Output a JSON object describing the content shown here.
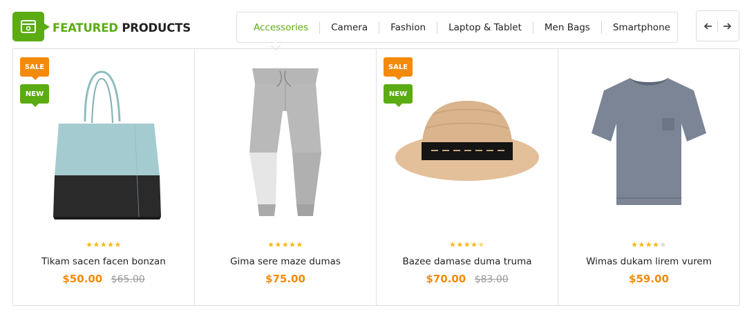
{
  "header": {
    "title_part1": "FEATURED",
    "title_part2": "PRODUCTS",
    "title_icon": "window-icon",
    "accent_color": "#5bac12"
  },
  "tabs": [
    {
      "label": "Accessories",
      "active": true
    },
    {
      "label": "Camera",
      "active": false
    },
    {
      "label": "Fashion",
      "active": false
    },
    {
      "label": "Laptop & Tablet",
      "active": false
    },
    {
      "label": "Men Bags",
      "active": false
    },
    {
      "label": "Smartphone",
      "active": false
    }
  ],
  "nav": {
    "prev_icon": "arrow-left-icon",
    "next_icon": "arrow-right-icon"
  },
  "badges": {
    "sale": "SALE",
    "new": "NEW",
    "sale_color": "#f48a0a",
    "new_color": "#5bac12"
  },
  "products": [
    {
      "name": "Tikam sacen facen bonzan",
      "price": "$50.00",
      "old_price": "$65.00",
      "rating": 5,
      "sale": true,
      "new": true,
      "image": "tote-bag"
    },
    {
      "name": "Gima sere maze dumas",
      "price": "$75.00",
      "old_price": "",
      "rating": 5,
      "sale": false,
      "new": false,
      "image": "sweatpants"
    },
    {
      "name": "Bazee damase duma truma",
      "price": "$70.00",
      "old_price": "$83.00",
      "rating": 4.5,
      "sale": true,
      "new": true,
      "image": "straw-hat"
    },
    {
      "name": "Wimas dukam lirem vurem",
      "price": "$59.00",
      "old_price": "",
      "rating": 4,
      "sale": false,
      "new": false,
      "image": "tshirt"
    }
  ]
}
